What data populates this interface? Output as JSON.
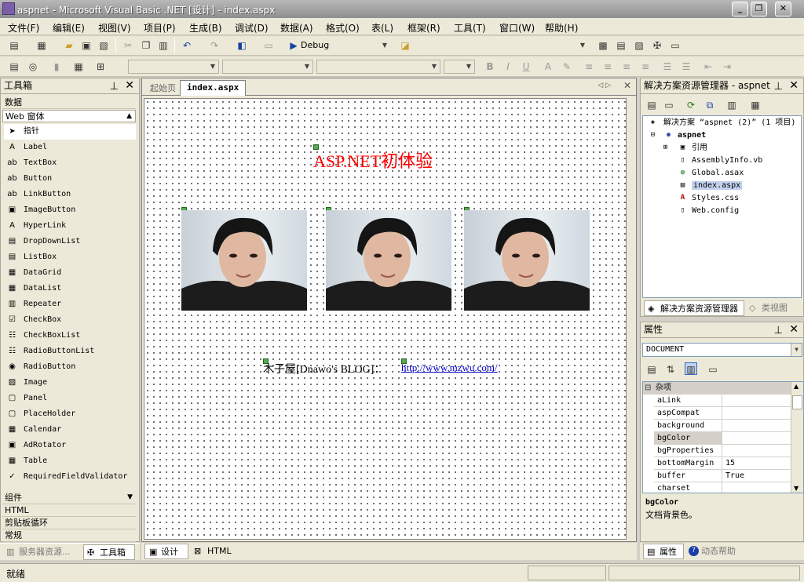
{
  "window": {
    "title": "aspnet - Microsoft Visual Basic .NET [设计] - index.aspx"
  },
  "menu": [
    "文件(F)",
    "编辑(E)",
    "视图(V)",
    "项目(P)",
    "生成(B)",
    "调试(D)",
    "数据(A)",
    "格式(O)",
    "表(L)",
    "框架(R)",
    "工具(T)",
    "窗口(W)",
    "帮助(H)"
  ],
  "toolbar": {
    "config": "Debug"
  },
  "toolbox": {
    "title": "工具箱",
    "section_data": "数据",
    "section_web": "Web 窗体",
    "items": [
      "指针",
      "Label",
      "TextBox",
      "Button",
      "LinkButton",
      "ImageButton",
      "HyperLink",
      "DropDownList",
      "ListBox",
      "DataGrid",
      "DataList",
      "Repeater",
      "CheckBox",
      "CheckBoxList",
      "RadioButtonList",
      "RadioButton",
      "Image",
      "Panel",
      "PlaceHolder",
      "Calendar",
      "AdRotator",
      "Table",
      "RequiredFieldValidator"
    ],
    "section_components": "组件",
    "section_html": "HTML",
    "section_clipboard": "剪贴板循环",
    "section_general": "常规",
    "bottom_tabs": [
      "服务器资源...",
      "工具箱"
    ]
  },
  "document": {
    "tabs": [
      "起始页",
      "index.aspx"
    ],
    "heading": "ASP.NET初体验",
    "footer_text": "木子屋[Dnawo's BLOG]：",
    "footer_link": "http://www.mzwu.com/",
    "view_tabs": [
      "设计",
      "HTML"
    ]
  },
  "solution_explorer": {
    "title": "解决方案资源管理器 - aspnet",
    "solution": "解决方案 “aspnet (2)” (1 项目)",
    "project": "aspnet",
    "items": [
      "引用",
      "AssemblyInfo.vb",
      "Global.asax",
      "index.aspx",
      "Styles.css",
      "Web.config"
    ],
    "bottom_tabs": [
      "解决方案资源管理器",
      "类视图"
    ]
  },
  "properties": {
    "title": "属性",
    "object": "DOCUMENT",
    "category": "杂项",
    "rows": [
      {
        "name": "aLink",
        "value": ""
      },
      {
        "name": "aspCompat",
        "value": ""
      },
      {
        "name": "background",
        "value": ""
      },
      {
        "name": "bgColor",
        "value": ""
      },
      {
        "name": "bgProperties",
        "value": ""
      },
      {
        "name": "bottomMargin",
        "value": "15"
      },
      {
        "name": "buffer",
        "value": "True"
      },
      {
        "name": "charset",
        "value": ""
      }
    ],
    "desc_title": "bgColor",
    "desc_text": "文档背景色。",
    "bottom_tabs": [
      "属性",
      "动态帮助"
    ]
  },
  "status": {
    "text": "就绪"
  },
  "colors": {
    "heading": "#ff0000",
    "link": "#0000cc",
    "selection": "#c1d2ee"
  }
}
